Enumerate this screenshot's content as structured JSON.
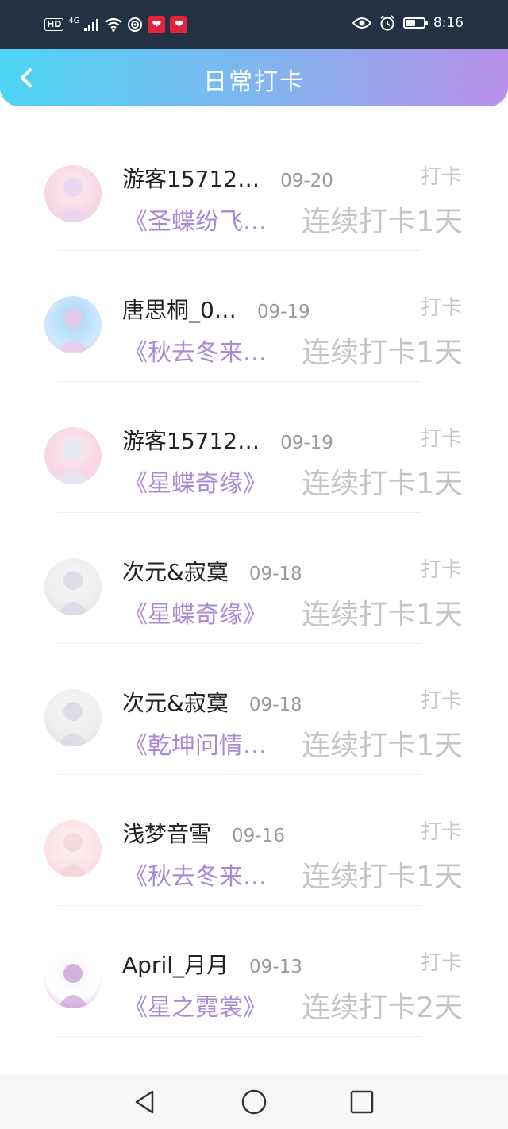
{
  "status": {
    "hd": "HD",
    "network": "4G",
    "time": "8:16",
    "battery_level": 0.55,
    "notification_icon": "❤"
  },
  "header": {
    "title": "日常打卡"
  },
  "entries": [
    {
      "user": "游客15712…",
      "date": "09-20",
      "book": "《圣蝶纷飞…",
      "streak": "连续打卡1天",
      "action": "打卡"
    },
    {
      "user": "唐思桐_0…",
      "date": "09-19",
      "book": "《秋去冬来…",
      "streak": "连续打卡1天",
      "action": "打卡"
    },
    {
      "user": "游客15712…",
      "date": "09-19",
      "book": "《星蝶奇缘》",
      "streak": "连续打卡1天",
      "action": "打卡"
    },
    {
      "user": "次元&寂寞",
      "date": "09-18",
      "book": "《星蝶奇缘》",
      "streak": "连续打卡1天",
      "action": "打卡"
    },
    {
      "user": "次元&寂寞",
      "date": "09-18",
      "book": "《乾坤问情…",
      "streak": "连续打卡1天",
      "action": "打卡"
    },
    {
      "user": "浅梦音雪",
      "date": "09-16",
      "book": "《秋去冬来…",
      "streak": "连续打卡1天",
      "action": "打卡"
    },
    {
      "user": "April_月月",
      "date": "09-13",
      "book": "《星之霓裳》",
      "streak": "连续打卡2天",
      "action": "打卡"
    }
  ],
  "colors": {
    "header_gradient_start": "#4dd4f4",
    "header_gradient_end": "#b890ea",
    "book_title": "#a98ad6",
    "muted": "#c4c4c4"
  }
}
